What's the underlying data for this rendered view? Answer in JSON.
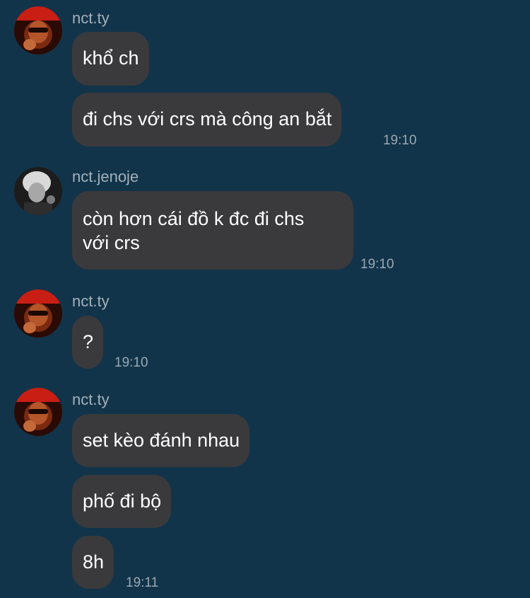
{
  "colors": {
    "background": "#12344a",
    "bubble": "#3a3a3c",
    "text": "#ffffff",
    "meta": "#a3b0b9"
  },
  "groups": [
    {
      "sender": "nct.ty",
      "avatar": "avatar-red",
      "messages": [
        "khổ ch",
        "đi chs với crs mà công an bắt"
      ],
      "time": "19:10"
    },
    {
      "sender": "nct.jenoje",
      "avatar": "avatar-gray",
      "messages": [
        "còn hơn cái đồ k đc đi chs\nvới crs"
      ],
      "time": "19:10"
    },
    {
      "sender": "nct.ty",
      "avatar": "avatar-red",
      "messages": [
        "?"
      ],
      "time": "19:10"
    },
    {
      "sender": "nct.ty",
      "avatar": "avatar-red",
      "messages": [
        "set kèo đánh nhau",
        "phố đi bộ",
        "8h"
      ],
      "time": "19:11"
    }
  ]
}
